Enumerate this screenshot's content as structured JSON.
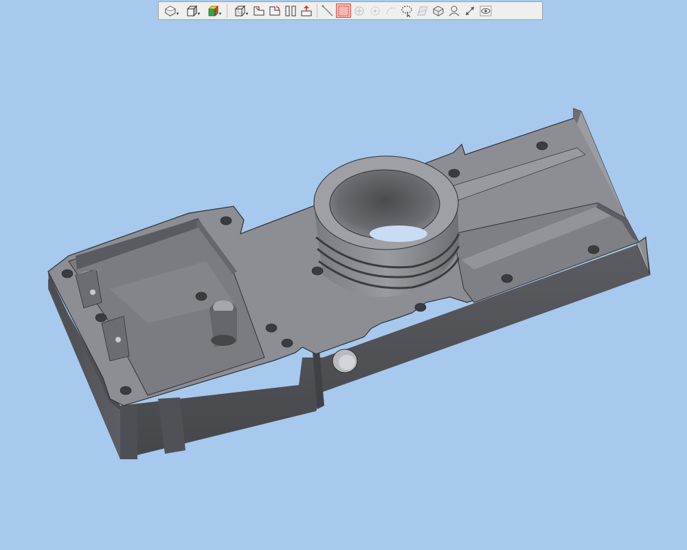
{
  "colors": {
    "background": "#a7c9ee",
    "toolbar_bg": "#efefef",
    "model_top": "#8a8b90",
    "model_side": "#57585d",
    "model_dark": "#3d3e42",
    "active_tool": "#f3b7b3"
  },
  "toolbar": {
    "groups": [
      [
        {
          "icon": "view-orientation-icon",
          "has_dropdown": true
        },
        {
          "icon": "display-style-box-icon",
          "has_dropdown": true
        },
        {
          "icon": "appearance-color-cube-icon",
          "has_dropdown": true
        }
      ],
      [
        {
          "icon": "view-cube-icon",
          "has_dropdown": true
        },
        {
          "icon": "section-view-icon",
          "has_dropdown": false
        },
        {
          "icon": "rotate-section-icon",
          "has_dropdown": false
        },
        {
          "icon": "split-view-icon",
          "has_dropdown": false
        },
        {
          "icon": "explode-view-icon",
          "has_dropdown": false
        }
      ],
      [
        {
          "icon": "measure-line-icon",
          "state": "normal"
        },
        {
          "icon": "select-box-icon",
          "state": "active"
        },
        {
          "icon": "select-point-icon",
          "state": "disabled"
        },
        {
          "icon": "select-vertex-icon",
          "state": "disabled"
        },
        {
          "icon": "select-edge-icon",
          "state": "disabled"
        },
        {
          "icon": "lasso-select-icon",
          "state": "normal"
        },
        {
          "icon": "select-face-icon",
          "state": "disabled"
        },
        {
          "icon": "select-body-icon",
          "state": "normal"
        },
        {
          "icon": "select-component-icon",
          "state": "normal"
        },
        {
          "icon": "pan-arrows-icon",
          "state": "normal"
        },
        {
          "icon": "visibility-eye-icon",
          "state": "normal"
        }
      ]
    ]
  },
  "model": {
    "name": "3d-housing-part"
  }
}
